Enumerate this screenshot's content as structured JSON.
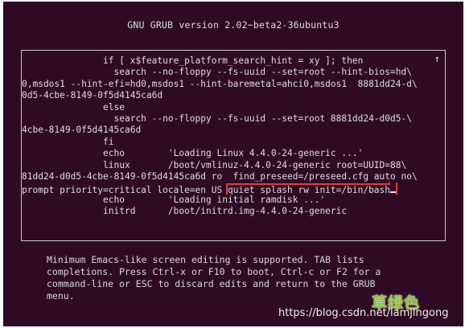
{
  "header": {
    "title": "GNU GRUB  version 2.02~beta2-36ubuntu3"
  },
  "editor": {
    "scroll_indicator": "↑",
    "lines": [
      "               if [ x$feature_platform_search_hint = xy ]; then",
      "                 search --no-floppy --fs-uuid --set=root --hint-bios=hd\\",
      "0,msdos1 --hint-efi=hd0,msdos1 --hint-baremetal=ahci0,msdos1  8881dd24-d\\",
      "0d5-4cbe-8149-0f5d4145ca6d",
      "               else",
      "                 search --no-floppy --fs-uuid --set=root 8881dd24-d0d5-\\",
      "4cbe-8149-0f5d4145ca6d",
      "               fi",
      "               echo        'Loading Linux 4.4.0-24-generic ...'",
      "               linux       /boot/vmlinuz-4.4.0-24-generic root=UUID=88\\",
      "81dd24-d0d5-4cbe-8149-0f5d4145ca6d ro  find_preseed=/preseed.cfg auto no\\"
    ],
    "edited_line_prefix": "prompt priority=critical locale=en_US ",
    "edited_line_highlight": "quiet splash rw init=/bin/bash",
    "lines_after": [
      "               echo        'Loading initial ramdisk ...'",
      "               initrd      /boot/initrd.img-4.4.0-24-generic"
    ]
  },
  "help": {
    "text": "Minimum Emacs-like screen editing is supported. TAB lists\ncompletions. Press Ctrl-x or F10 to boot, Ctrl-c or F2 for a\ncommand-line or ESC to discard edits and return to the GRUB\nmenu."
  },
  "watermark": {
    "url": "https://blog.csdn.net/lamjingong",
    "logo": "草绿色"
  },
  "colors": {
    "background": "#2f0a25",
    "text": "#d9d9d9",
    "highlight_box": "#e23b3b",
    "logo": "#8fc33a"
  }
}
